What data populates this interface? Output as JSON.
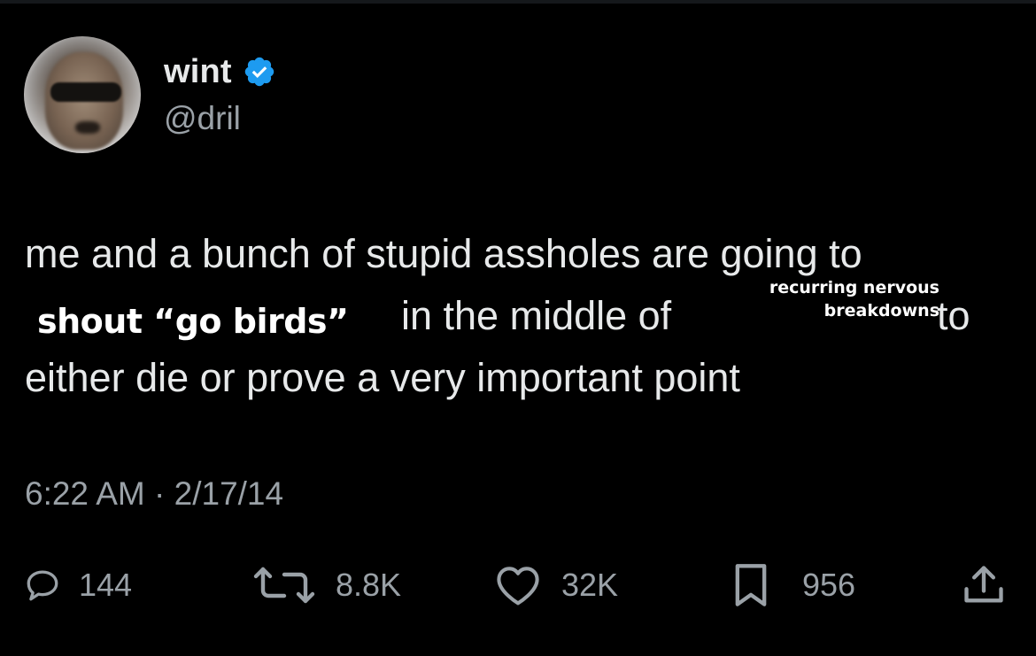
{
  "author": {
    "display_name": "wint",
    "handle": "@dril",
    "verified": true,
    "verified_color": "#1d9bf0"
  },
  "tweet": {
    "line1": "me and a bunch of stupid assholes are going to",
    "overlay_1": "shout “go birds”",
    "line2_mid": "in the middle of",
    "overlay_2_line1": "recurring nervous",
    "overlay_2_line2": "breakdowns",
    "line2_end": "to",
    "line3": "either die or prove a very important point"
  },
  "meta": {
    "timestamp": "6:22 AM · 2/17/14"
  },
  "actions": {
    "replies": {
      "icon": "reply-icon",
      "count": "144"
    },
    "reposts": {
      "icon": "repost-icon",
      "count": "8.8K"
    },
    "likes": {
      "icon": "heart-icon",
      "count": "32K"
    },
    "bookmarks": {
      "icon": "bookmark-icon",
      "count": "956"
    },
    "share": {
      "icon": "share-icon"
    }
  },
  "colors": {
    "background": "#000000",
    "text_primary": "#e7e9ea",
    "text_secondary": "#9aa1a7",
    "overlay_text": "#ffffff"
  }
}
